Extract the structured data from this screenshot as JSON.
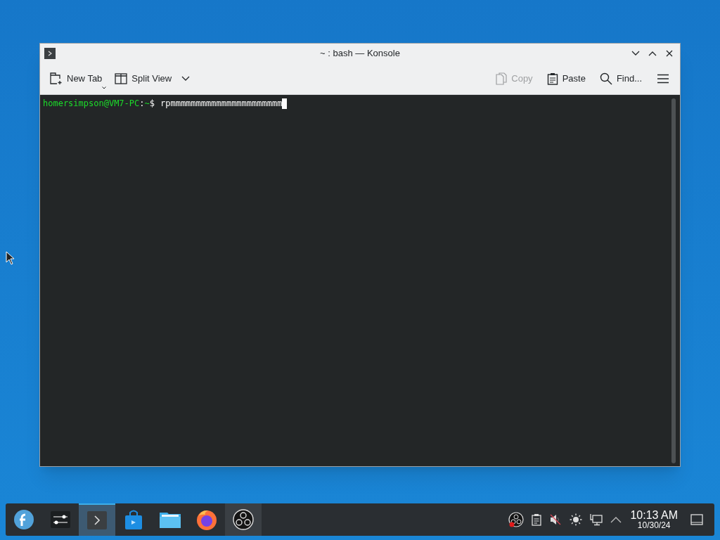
{
  "window": {
    "title": "~ : bash — Konsole"
  },
  "toolbar": {
    "left": [
      {
        "kind": "new-tab",
        "label": "New Tab",
        "disabled": false
      },
      {
        "kind": "split",
        "label": "Split View",
        "disabled": false
      }
    ],
    "right": [
      {
        "kind": "copy",
        "label": "Copy",
        "disabled": true
      },
      {
        "kind": "paste",
        "label": "Paste",
        "disabled": false
      },
      {
        "kind": "find",
        "label": "Find...",
        "disabled": false
      }
    ]
  },
  "terminal": {
    "prompt_user": "homersimpson@VM7-PC",
    "prompt_sep": ":",
    "prompt_path": "~",
    "prompt_symbol": "$",
    "command": "rpmmmmmmmmmmmmmmmmmmmmmm"
  },
  "taskbar": {
    "tasks": [
      {
        "kind": "launcher",
        "selected": false,
        "running": false
      },
      {
        "kind": "settings",
        "selected": false,
        "running": false
      },
      {
        "kind": "terminal",
        "selected": true,
        "running": true
      },
      {
        "kind": "store",
        "selected": false,
        "running": false
      },
      {
        "kind": "files",
        "selected": false,
        "running": false
      },
      {
        "kind": "browser",
        "selected": false,
        "running": false
      },
      {
        "kind": "obs",
        "selected": false,
        "running": true
      }
    ],
    "tray": [
      {
        "kind": "obs"
      },
      {
        "kind": "clipboard"
      },
      {
        "kind": "volume"
      },
      {
        "kind": "brightness"
      },
      {
        "kind": "network"
      },
      {
        "kind": "expand"
      }
    ],
    "clock": {
      "time": "10:13 AM",
      "date": "10/30/24"
    }
  }
}
